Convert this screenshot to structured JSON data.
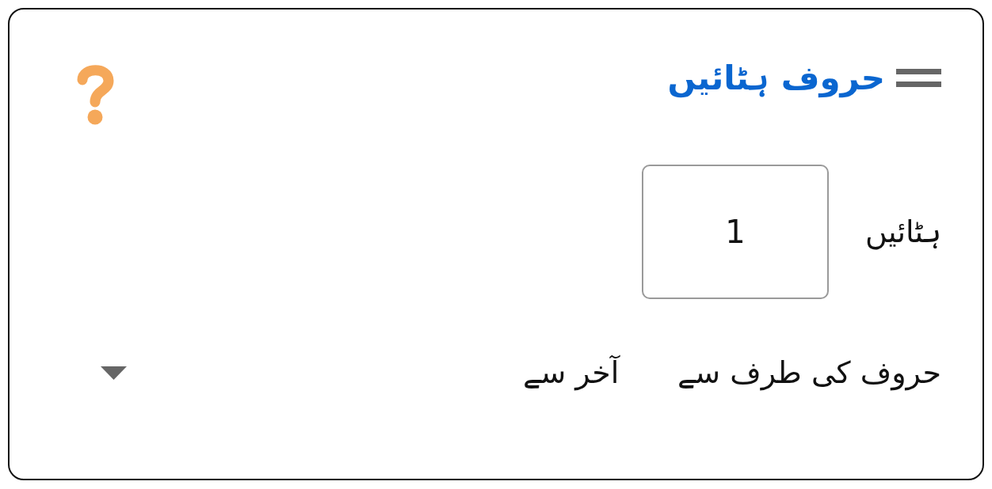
{
  "block": {
    "title": "حروف ہٹائیں"
  },
  "fields": [
    {
      "kind": "number",
      "label": "ہٹائیں",
      "value": "1"
    },
    {
      "kind": "dropdown",
      "label": "حروف کی طرف سے",
      "value": "آخر سے"
    }
  ]
}
